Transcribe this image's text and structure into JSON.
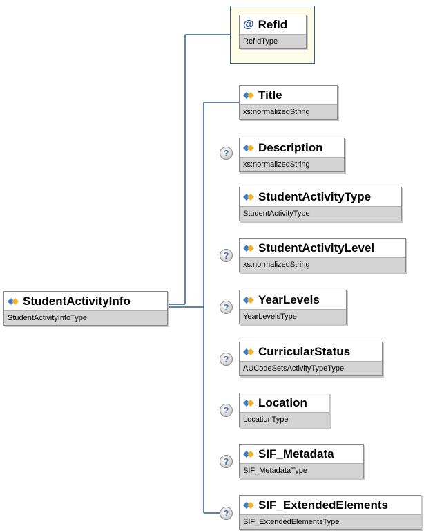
{
  "root": {
    "name": "StudentActivityInfo",
    "type": "StudentActivityInfoType"
  },
  "attribute": {
    "symbol": "@",
    "name": "RefId",
    "type": "RefIdType"
  },
  "elements": [
    {
      "name": "Title",
      "type": "xs:normalizedString",
      "optional": false
    },
    {
      "name": "Description",
      "type": "xs:normalizedString",
      "optional": true
    },
    {
      "name": "StudentActivityType",
      "type": "StudentActivityType",
      "optional": false
    },
    {
      "name": "StudentActivityLevel",
      "type": "xs:normalizedString",
      "optional": true
    },
    {
      "name": "YearLevels",
      "type": "YearLevelsType",
      "optional": true
    },
    {
      "name": "CurricularStatus",
      "type": "AUCodeSetsActivityTypeType",
      "optional": true
    },
    {
      "name": "Location",
      "type": "LocationType",
      "optional": true
    },
    {
      "name": "SIF_Metadata",
      "type": "SIF_MetadataType",
      "optional": true
    },
    {
      "name": "SIF_ExtendedElements",
      "type": "SIF_ExtendedElementsType",
      "optional": true
    }
  ],
  "optional_marker": "?",
  "colors": {
    "connector": "#2c5a9a",
    "type_bar": "#d4d4d4",
    "attribute_bg": "#fffce8"
  },
  "icons": {
    "element": "element-icon",
    "optional": "optional-marker-icon"
  }
}
